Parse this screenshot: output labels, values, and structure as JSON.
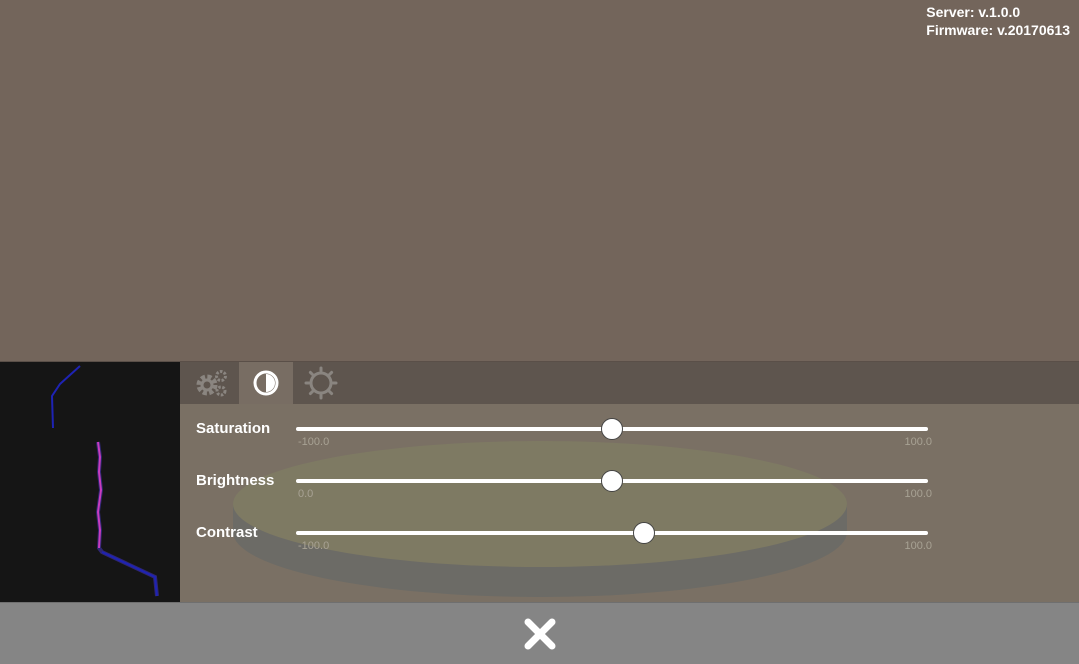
{
  "version": {
    "server": "Server: v.1.0.0",
    "firmware": "Firmware: v.20170613"
  },
  "tabs": [
    {
      "icon": "gears-icon",
      "active": false
    },
    {
      "icon": "contrast-icon",
      "active": true
    },
    {
      "icon": "brightness-icon",
      "active": false
    }
  ],
  "sliders": [
    {
      "label": "Saturation",
      "min": "-100.0",
      "max": "100.0",
      "value": 0
    },
    {
      "label": "Brightness",
      "min": "0.0",
      "max": "100.0",
      "value": 50
    },
    {
      "label": "Contrast",
      "min": "-100.0",
      "max": "100.0",
      "value": 10
    }
  ],
  "colors": {
    "background": "#73655b",
    "bottom_bar": "#858585",
    "preview_line": "#1e23b4",
    "preview_highlight": "#c83cbe"
  },
  "close_icon": "close-icon"
}
